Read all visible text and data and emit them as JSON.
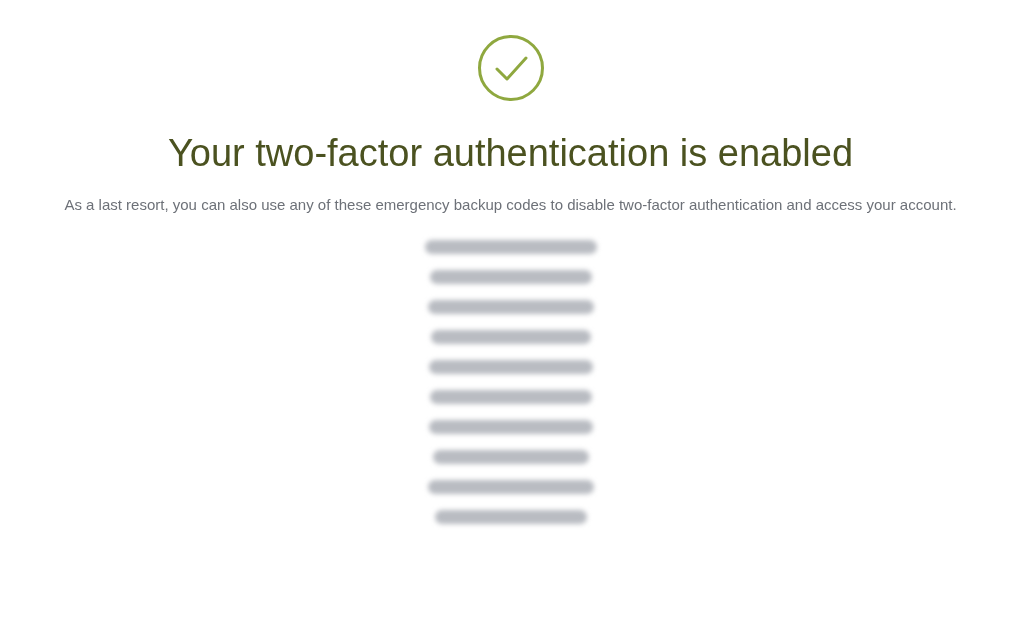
{
  "title": "Your two-factor authentication is enabled",
  "message": "As a last resort, you can also use any of these emergency backup codes to disable two-factor authentication and access your account.",
  "backup_codes": [
    {
      "kind": "blurred"
    },
    {
      "kind": "blurred"
    },
    {
      "kind": "blurred"
    },
    {
      "kind": "blurred"
    },
    {
      "kind": "blurred"
    },
    {
      "kind": "blurred"
    },
    {
      "kind": "blurred"
    },
    {
      "kind": "blurred"
    },
    {
      "kind": "blurred"
    },
    {
      "kind": "blurred"
    }
  ]
}
